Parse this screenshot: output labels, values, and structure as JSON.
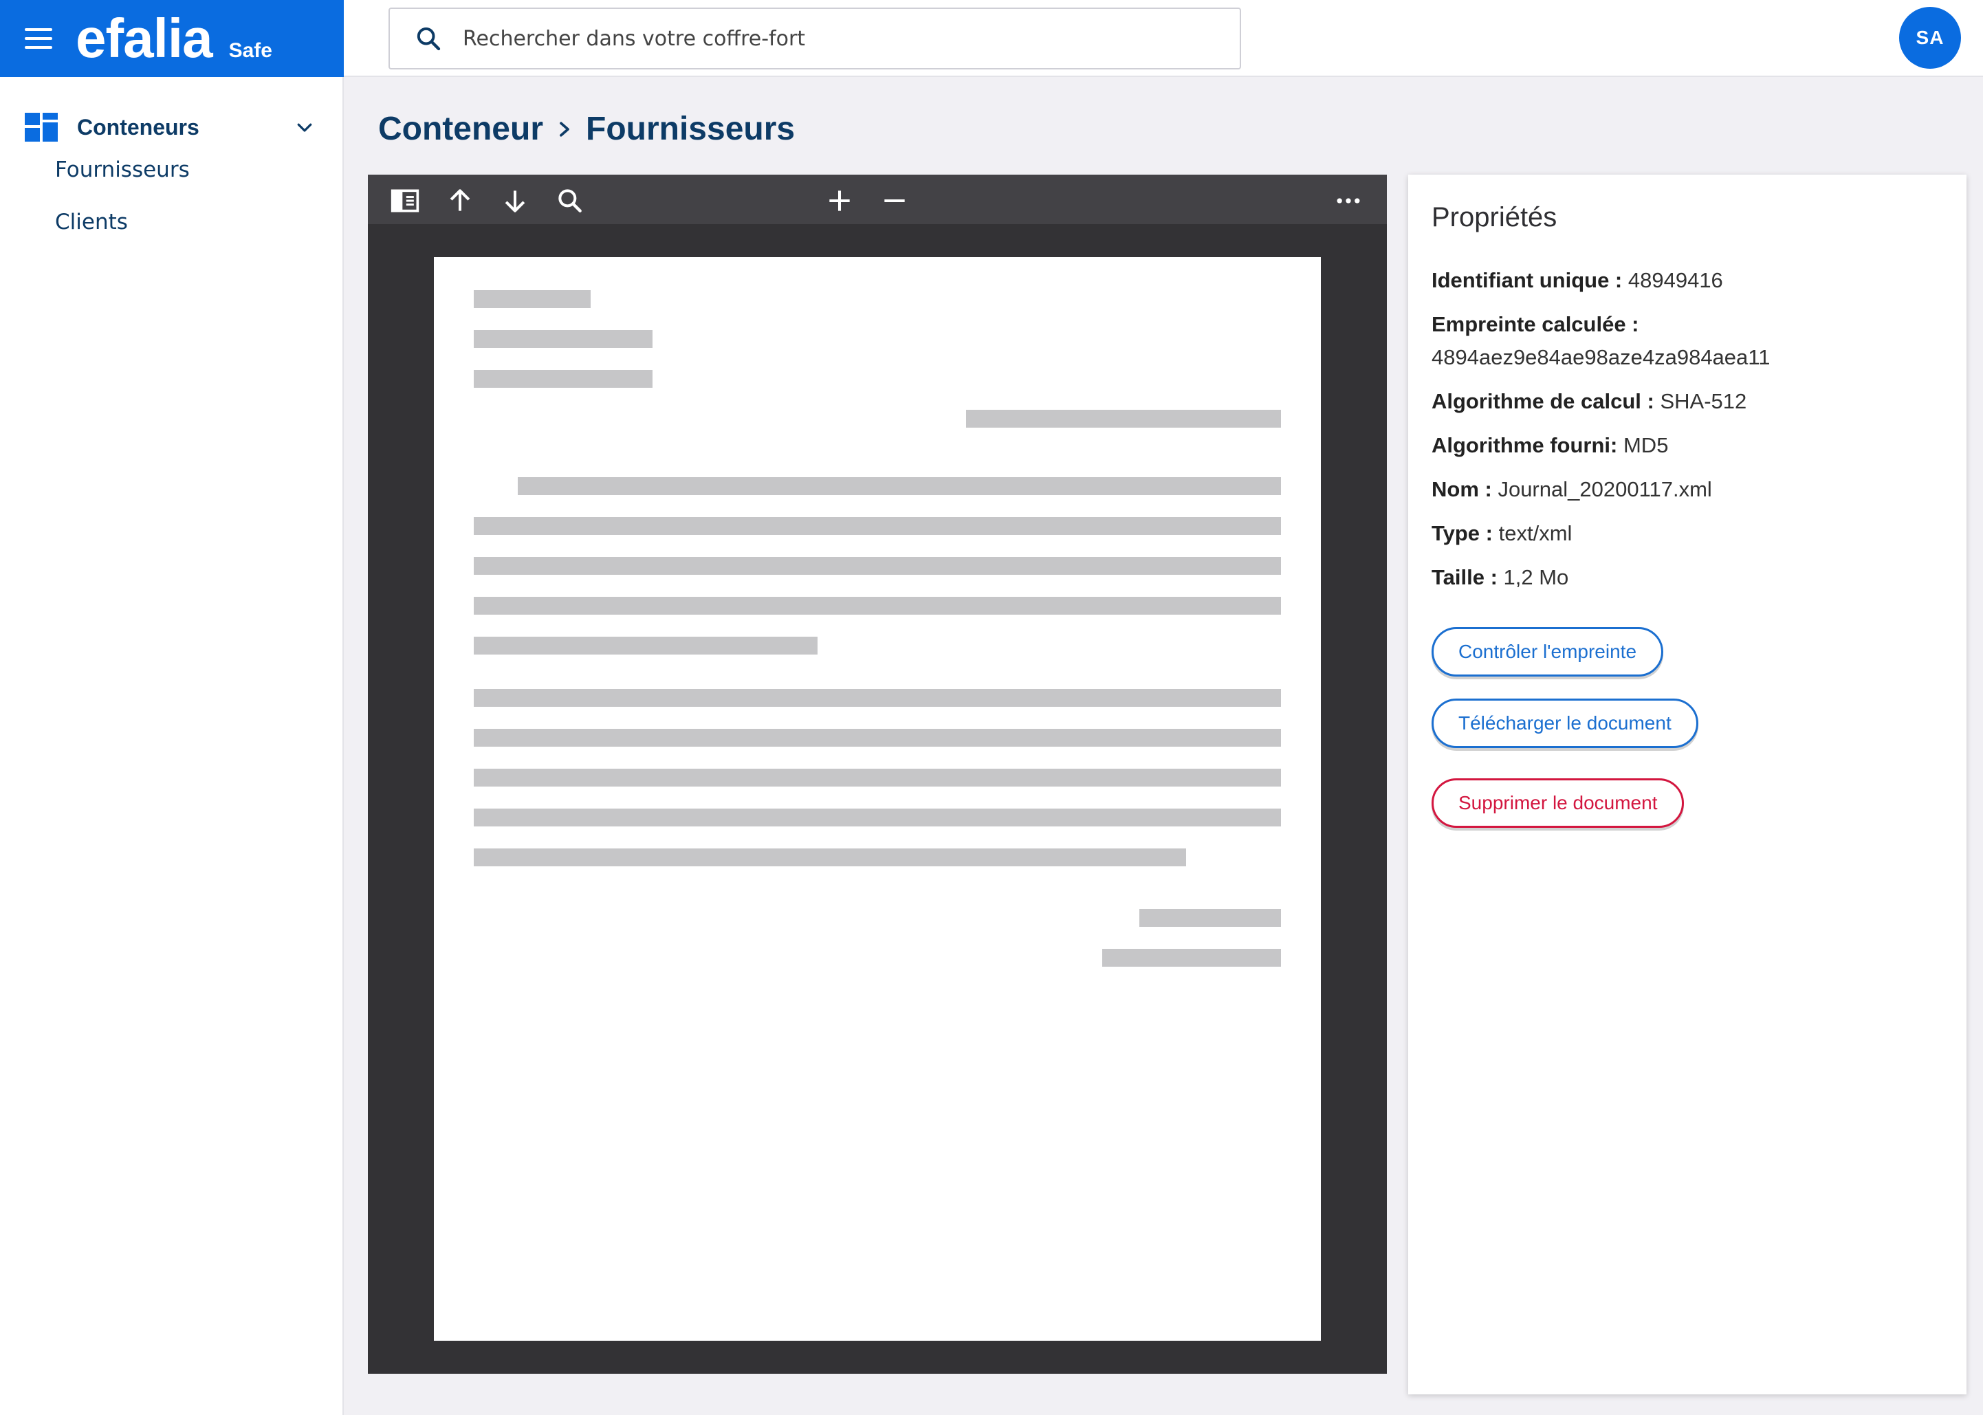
{
  "brand": {
    "name": "efalia",
    "product": "Safe"
  },
  "search": {
    "placeholder": "Rechercher dans votre coffre-fort"
  },
  "user": {
    "initials": "SA"
  },
  "sidebar": {
    "section_label": "Conteneurs",
    "items": [
      {
        "label": "Fournisseurs"
      },
      {
        "label": "Clients"
      }
    ]
  },
  "breadcrumb": {
    "root": "Conteneur",
    "current": "Fournisseurs"
  },
  "properties": {
    "title": "Propriétés",
    "unique_id": {
      "label": "Identifiant unique :",
      "value": "48949416"
    },
    "hash": {
      "label": "Empreinte calculée :",
      "value": "4894aez9e84ae98aze4za984aea11"
    },
    "calc_algo": {
      "label": "Algorithme de calcul :",
      "value": "SHA-512"
    },
    "given_algo": {
      "label": "Algorithme fourni:",
      "value": "MD5"
    },
    "name": {
      "label": "Nom :",
      "value": "Journal_20200117.xml"
    },
    "type": {
      "label": "Type :",
      "value": "text/xml"
    },
    "size": {
      "label": "Taille :",
      "value": "1,2 Mo"
    }
  },
  "actions": {
    "check": "Contrôler l'empreinte",
    "download": "Télécharger le document",
    "delete": "Supprimer le document"
  },
  "colors": {
    "brand": "#0a6ce0",
    "title": "#0d3b66",
    "danger": "#d3163f",
    "viewer_bg": "#333235"
  }
}
